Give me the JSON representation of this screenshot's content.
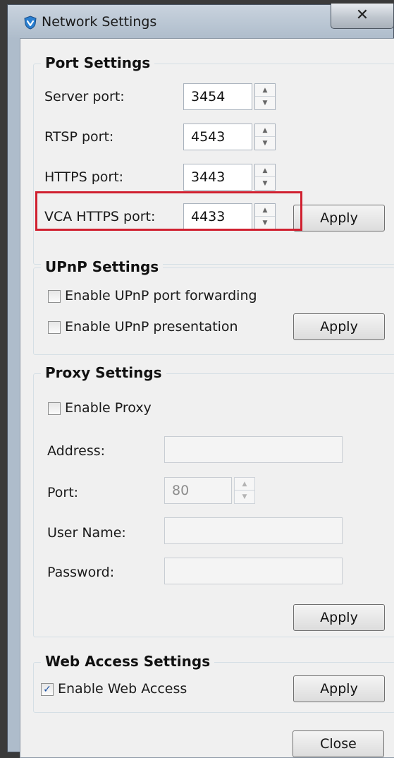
{
  "window": {
    "title": "Network Settings",
    "close_glyph": "✕"
  },
  "port_settings": {
    "title": "Port Settings",
    "server_port": {
      "label": "Server port:",
      "value": "3454"
    },
    "rtsp_port": {
      "label": "RTSP port:",
      "value": "4543"
    },
    "https_port": {
      "label": "HTTPS port:",
      "value": "3443"
    },
    "vca_https_port": {
      "label": "VCA HTTPS port:",
      "value": "4433"
    },
    "apply_label": "Apply"
  },
  "upnp_settings": {
    "title": "UPnP Settings",
    "port_forwarding": {
      "label": "Enable UPnP port forwarding",
      "checked": false
    },
    "presentation": {
      "label": "Enable UPnP presentation",
      "checked": false
    },
    "apply_label": "Apply"
  },
  "proxy_settings": {
    "title": "Proxy Settings",
    "enable_proxy": {
      "label": "Enable Proxy",
      "checked": false
    },
    "address": {
      "label": "Address:",
      "value": ""
    },
    "port": {
      "label": "Port:",
      "value": "80"
    },
    "user_name": {
      "label": "User Name:",
      "value": ""
    },
    "password": {
      "label": "Password:",
      "value": ""
    },
    "apply_label": "Apply"
  },
  "web_access_settings": {
    "title": "Web Access Settings",
    "enable_web_access": {
      "label": "Enable Web Access",
      "checked": true,
      "check_glyph": "✓"
    },
    "apply_label": "Apply"
  },
  "close_label": "Close",
  "spinner": {
    "up_glyph": "▲",
    "down_glyph": "▼"
  },
  "colors": {
    "highlight": "#d02030",
    "title_bar": "#aebccb",
    "app_icon": "#2a7fd0"
  }
}
